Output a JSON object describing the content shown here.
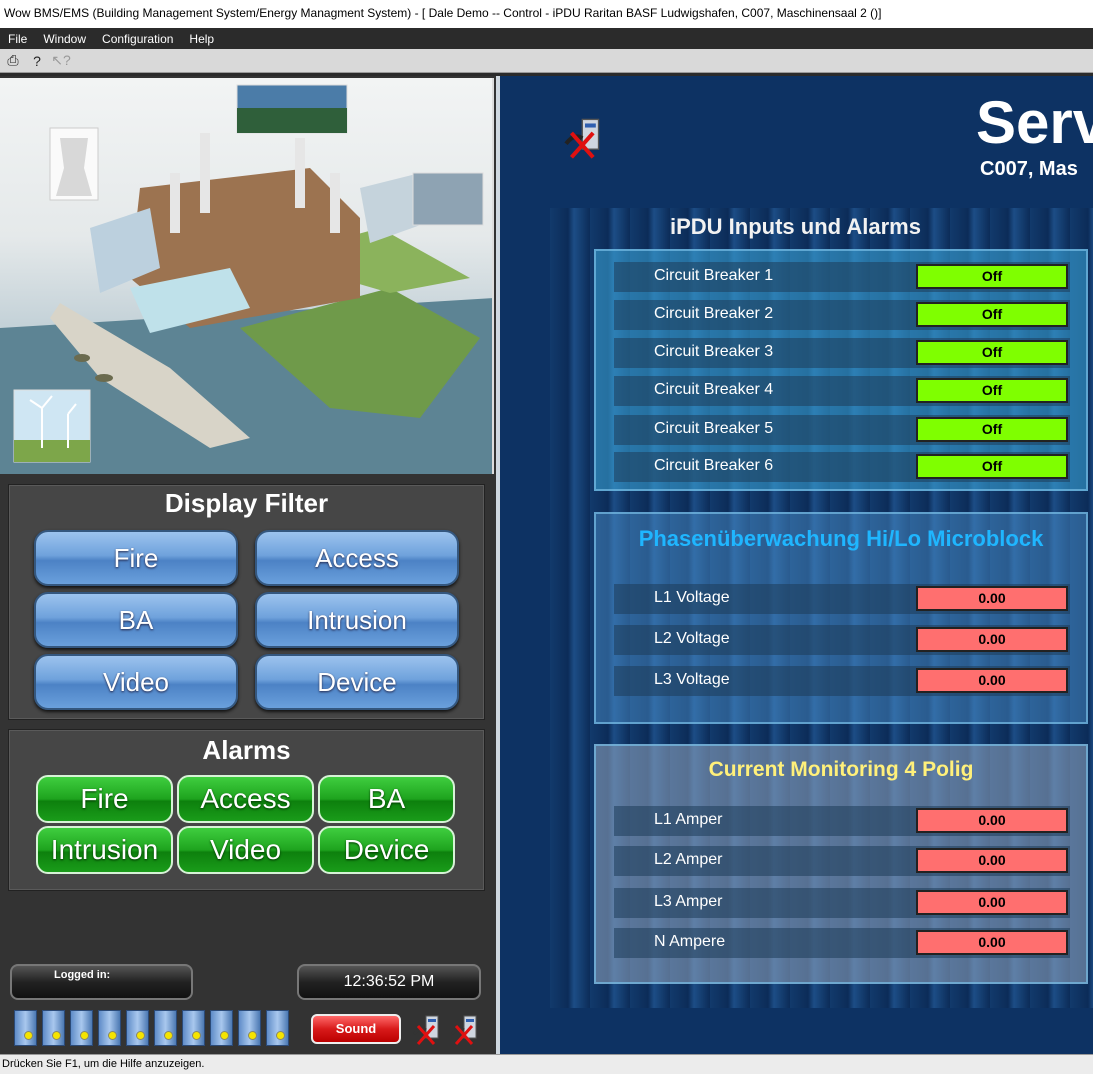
{
  "window": {
    "title": "Wow BMS/EMS (Building Management System/Energy Managment System) - [ Dale Demo -- Control - iPDU Raritan BASF Ludwigshafen, C007, Maschinensaal 2  ()]"
  },
  "menu": [
    "File",
    "Window",
    "Configuration",
    "Help"
  ],
  "toolbar": {
    "icons": [
      "printer-icon",
      "help-icon",
      "context-help-icon"
    ]
  },
  "display_filter": {
    "title": "Display Filter",
    "buttons": [
      "Fire",
      "Access",
      "BA",
      "Intrusion",
      "Video",
      "Device"
    ]
  },
  "alarms": {
    "title": "Alarms",
    "buttons": [
      "Fire",
      "Access",
      "BA",
      "Intrusion",
      "Video",
      "Device"
    ]
  },
  "footer": {
    "logged_in": "Logged in:",
    "clock": "12:36:52 PM",
    "sound": "Sound"
  },
  "server": {
    "title": "Serv",
    "subtitle": "C007, Mas"
  },
  "ipdu": {
    "title": "iPDU Inputs und Alarms",
    "rows": [
      {
        "label": "Circuit Breaker 1",
        "value": "Off"
      },
      {
        "label": "Circuit Breaker 2",
        "value": "Off"
      },
      {
        "label": "Circuit Breaker 3",
        "value": "Off"
      },
      {
        "label": "Circuit Breaker 4",
        "value": "Off"
      },
      {
        "label": "Circuit Breaker 5",
        "value": "Off"
      },
      {
        "label": "Circuit Breaker 6",
        "value": "Off"
      }
    ]
  },
  "phase": {
    "title": "Phasenüberwachung Hi/Lo Microblock",
    "rows": [
      {
        "label": "L1 Voltage",
        "value": "0.00"
      },
      {
        "label": "L2 Voltage",
        "value": "0.00"
      },
      {
        "label": "L3 Voltage",
        "value": "0.00"
      }
    ]
  },
  "current": {
    "title": "Current Monitoring 4 Polig",
    "rows": [
      {
        "label": "L1 Amper",
        "value": "0.00"
      },
      {
        "label": "L2 Amper",
        "value": "0.00"
      },
      {
        "label": "L3 Amper",
        "value": "0.00"
      },
      {
        "label": "N Ampere",
        "value": "0.00"
      }
    ]
  },
  "statusbar": {
    "text": "Drücken Sie F1, um die Hilfe anzuzeigen."
  },
  "colors": {
    "ok": "#7fff00",
    "alarm": "#ff6f6f",
    "phase_title": "#1fb6ff",
    "current_title": "#fff07a"
  }
}
